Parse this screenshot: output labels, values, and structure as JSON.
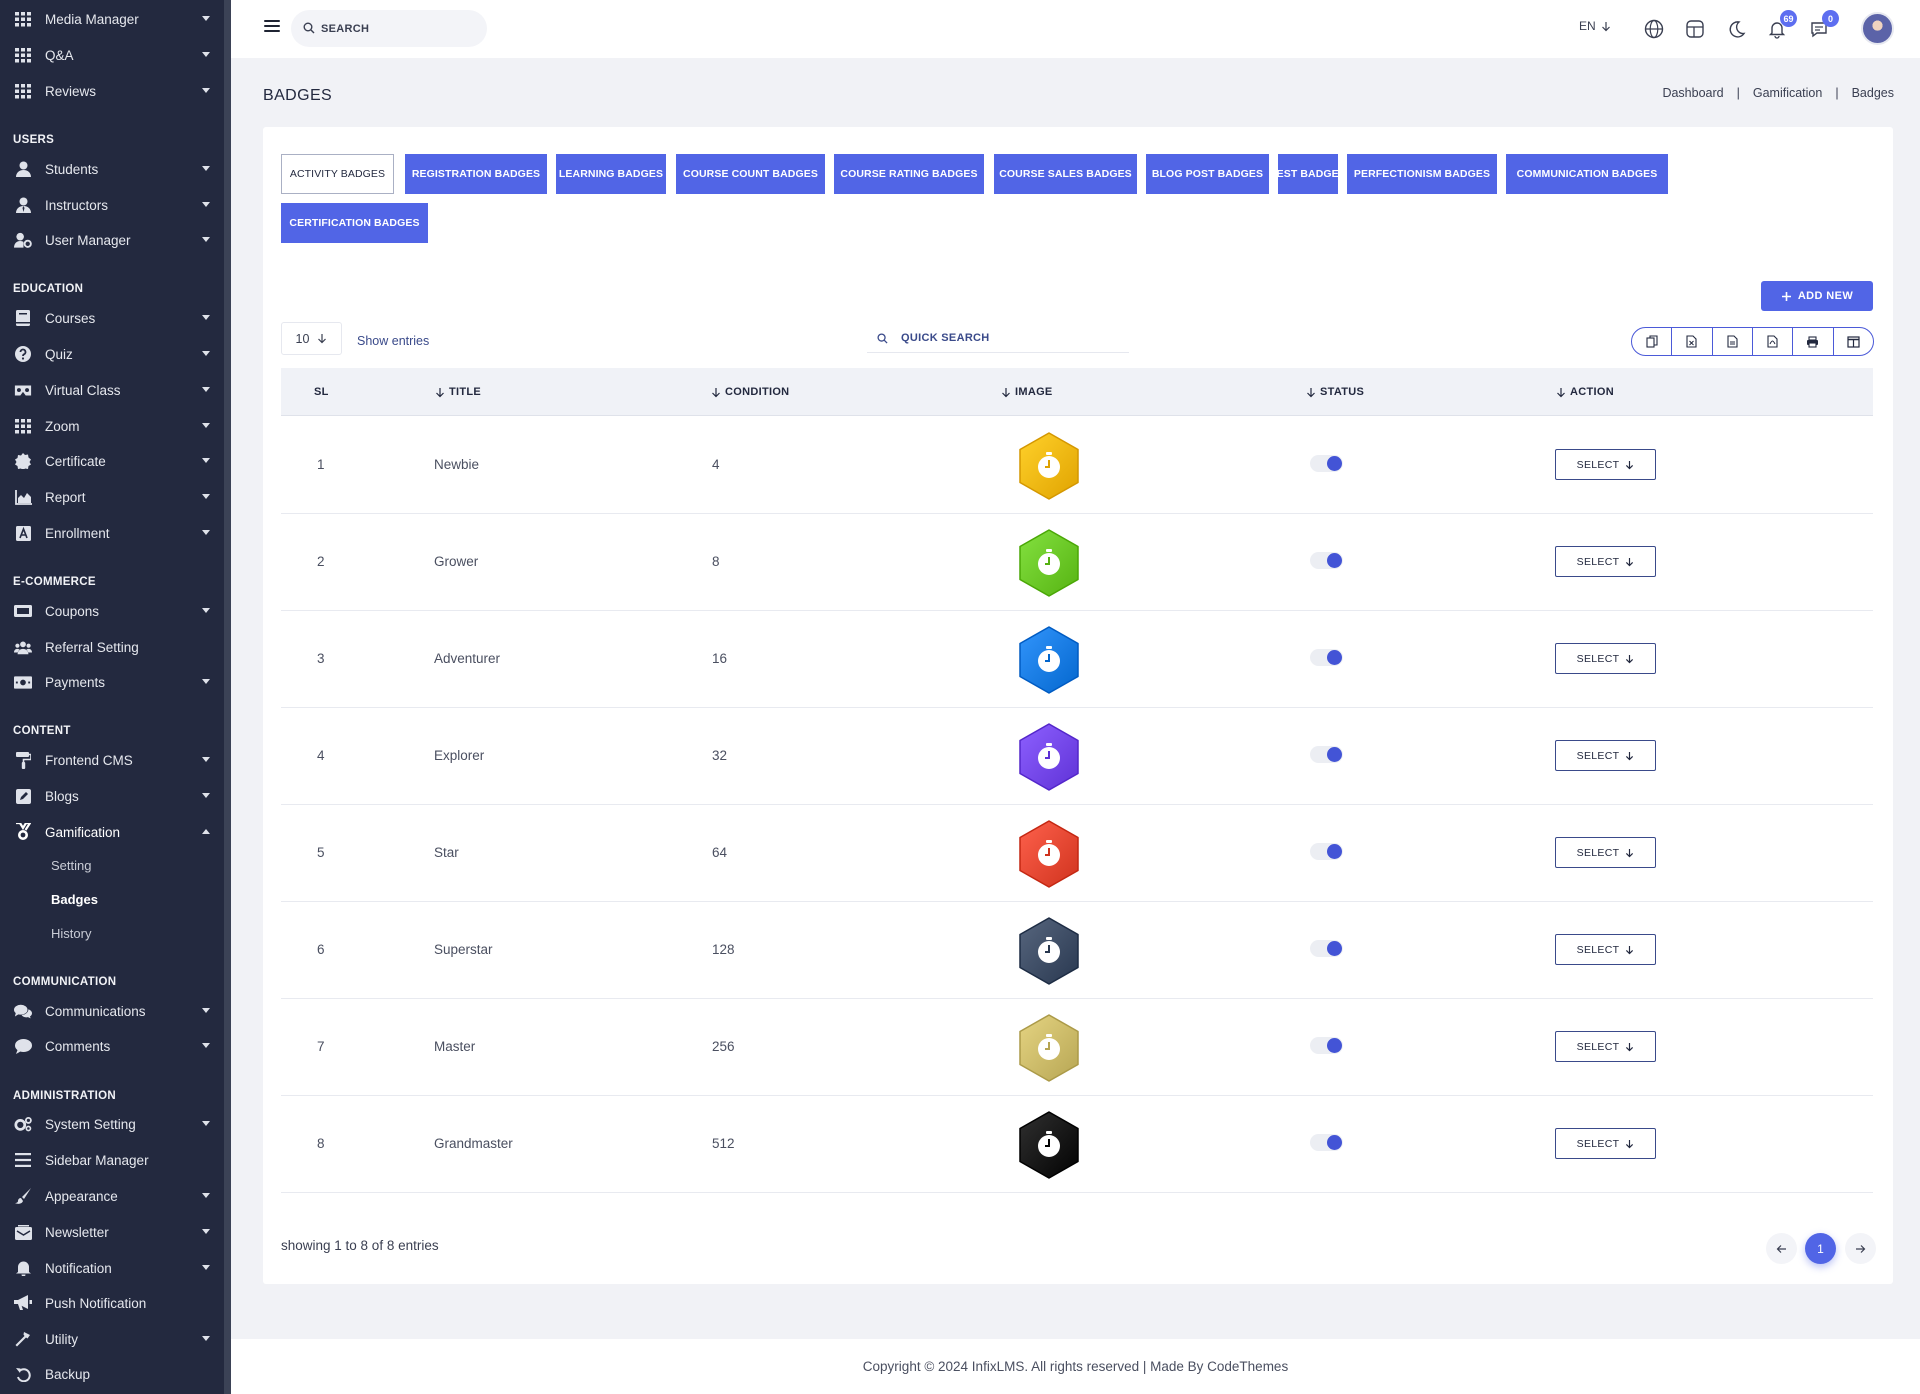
{
  "sidebar": {
    "items": [
      {
        "label": "Media Manager",
        "icon": "grid-icon",
        "caret": "down"
      },
      {
        "label": "Q&A",
        "icon": "grid-icon",
        "caret": "down"
      },
      {
        "label": "Reviews",
        "icon": "grid-icon",
        "caret": "down"
      },
      {
        "section": "USERS"
      },
      {
        "label": "Students",
        "icon": "user-icon",
        "caret": "down"
      },
      {
        "label": "Instructors",
        "icon": "user-tie-icon",
        "caret": "down"
      },
      {
        "label": "User Manager",
        "icon": "user-gear-icon",
        "caret": "down"
      },
      {
        "section": "EDUCATION"
      },
      {
        "label": "Courses",
        "icon": "book-icon",
        "caret": "down"
      },
      {
        "label": "Quiz",
        "icon": "question-circle-icon",
        "caret": "down"
      },
      {
        "label": "Virtual Class",
        "icon": "vr-goggles-icon",
        "caret": "down"
      },
      {
        "label": "Zoom",
        "icon": "grid-icon",
        "caret": "down"
      },
      {
        "label": "Certificate",
        "icon": "certificate-icon",
        "caret": "down"
      },
      {
        "label": "Report",
        "icon": "chart-area-icon",
        "caret": "down"
      },
      {
        "label": "Enrollment",
        "icon": "enrollment-icon",
        "caret": "down"
      },
      {
        "section": "E-COMMERCE"
      },
      {
        "label": "Coupons",
        "icon": "coupon-icon",
        "caret": "down"
      },
      {
        "label": "Referral Setting",
        "icon": "users-icon",
        "caret": ""
      },
      {
        "label": "Payments",
        "icon": "money-bill-icon",
        "caret": "down"
      },
      {
        "section": "CONTENT"
      },
      {
        "label": "Frontend CMS",
        "icon": "paint-roller-icon",
        "caret": "down"
      },
      {
        "label": "Blogs",
        "icon": "edit-icon",
        "caret": "down"
      },
      {
        "label": "Gamification",
        "icon": "medal-icon",
        "caret": "up"
      },
      {
        "sub": "Setting"
      },
      {
        "sub": "Badges",
        "active": true
      },
      {
        "sub": "History"
      },
      {
        "section": "COMMUNICATION"
      },
      {
        "label": "Communications",
        "icon": "comments-icon",
        "caret": "down"
      },
      {
        "label": "Comments",
        "icon": "comment-icon",
        "caret": "down"
      },
      {
        "section": "ADMINISTRATION"
      },
      {
        "label": "System Setting",
        "icon": "cogs-icon",
        "caret": "down"
      },
      {
        "label": "Sidebar Manager",
        "icon": "bars-icon",
        "caret": ""
      },
      {
        "label": "Appearance",
        "icon": "brush-icon",
        "caret": "down"
      },
      {
        "label": "Newsletter",
        "icon": "mail-bulk-icon",
        "caret": "down"
      },
      {
        "label": "Notification",
        "icon": "bell-icon",
        "caret": "down"
      },
      {
        "label": "Push Notification",
        "icon": "bullhorn-icon",
        "caret": ""
      },
      {
        "label": "Utility",
        "icon": "hammer-icon",
        "caret": "down"
      },
      {
        "label": "Backup",
        "icon": "undo-icon",
        "caret": ""
      }
    ]
  },
  "topbar": {
    "search_placeholder": "SEARCH",
    "language": "EN",
    "notifications_count": "69",
    "messages_count": "0"
  },
  "page": {
    "title": "BADGES",
    "breadcrumb": [
      "Dashboard",
      "Gamification",
      "Badges"
    ]
  },
  "tabs": [
    "ACTIVITY BADGES",
    "REGISTRATION BADGES",
    "LEARNING BADGES",
    "COURSE COUNT BADGES",
    "COURSE RATING BADGES",
    "COURSE SALES BADGES",
    "BLOG POST BADGES",
    "TEST BADGES",
    "PERFECTIONISM BADGES",
    "COMMUNICATION BADGES",
    "CERTIFICATION BADGES"
  ],
  "active_tab": "ACTIVITY BADGES",
  "toolbar": {
    "add_new": "ADD NEW",
    "page_length": "10",
    "show_entries": "Show entries",
    "quick_search_placeholder": "QUICK SEARCH"
  },
  "table": {
    "columns": [
      "SL",
      "TITLE",
      "CONDITION",
      "IMAGE",
      "STATUS",
      "ACTION"
    ],
    "select_label": "SELECT",
    "rows": [
      {
        "sl": "1",
        "title": "Newbie",
        "condition": "4",
        "color": "#f2b50f",
        "status": true
      },
      {
        "sl": "2",
        "title": "Grower",
        "condition": "8",
        "color": "#68c524",
        "status": true
      },
      {
        "sl": "3",
        "title": "Adventurer",
        "condition": "16",
        "color": "#1679e0",
        "status": true
      },
      {
        "sl": "4",
        "title": "Explorer",
        "condition": "32",
        "color": "#7144e8",
        "status": true
      },
      {
        "sl": "5",
        "title": "Star",
        "condition": "64",
        "color": "#e24530",
        "status": true
      },
      {
        "sl": "6",
        "title": "Superstar",
        "condition": "128",
        "color": "#3b4a62",
        "status": true
      },
      {
        "sl": "7",
        "title": "Master",
        "condition": "256",
        "color": "#c9b866",
        "status": true
      },
      {
        "sl": "8",
        "title": "Grandmaster",
        "condition": "512",
        "color": "#141414",
        "status": true
      }
    ]
  },
  "pagination": {
    "info": "showing 1 to 8 of 8 entries",
    "current_page": "1"
  },
  "footer": {
    "text": "Copyright © 2024 InfixLMS. All rights reserved | Made By CodeThemes"
  },
  "colors": {
    "accent": "#5165e6",
    "sidebar": "#23293f"
  }
}
